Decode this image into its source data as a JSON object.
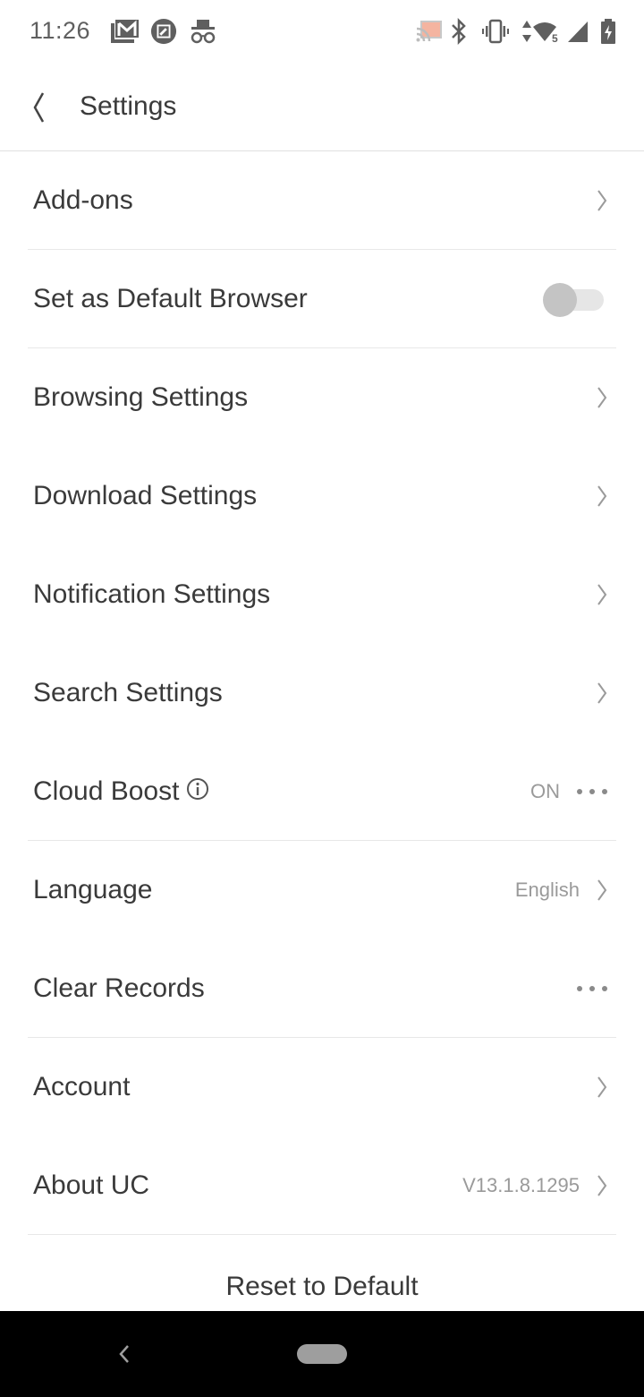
{
  "status_bar": {
    "time": "11:26",
    "left_icons": [
      "gmail-icon",
      "screenshot-edit-icon",
      "incognito-icon"
    ],
    "right_icons": [
      "cast-icon",
      "bluetooth-icon",
      "vibrate-icon",
      "data-arrows-icon",
      "wifi-icon",
      "signal-icon",
      "battery-charging-icon"
    ],
    "wifi_badge": "5",
    "cast_color": "#f4b4a0"
  },
  "header": {
    "back_icon": "chevron-left-icon",
    "title": "Settings"
  },
  "settings": {
    "items": [
      {
        "label": "Add-ons",
        "control": "chevron"
      },
      {
        "label": "Set as Default Browser",
        "control": "toggle",
        "toggle_on": false
      },
      {
        "label": "Browsing Settings",
        "control": "chevron"
      },
      {
        "label": "Download Settings",
        "control": "chevron"
      },
      {
        "label": "Notification Settings",
        "control": "chevron"
      },
      {
        "label": "Search Settings",
        "control": "chevron"
      },
      {
        "label": "Cloud Boost",
        "control": "more",
        "value": "ON",
        "has_info_icon": true
      },
      {
        "label": "Language",
        "control": "chevron",
        "value": "English"
      },
      {
        "label": "Clear Records",
        "control": "more"
      },
      {
        "label": "Account",
        "control": "chevron"
      },
      {
        "label": "About UC",
        "control": "chevron",
        "value": "V13.1.8.1295"
      }
    ]
  },
  "footer": {
    "reset_label": "Reset to Default"
  },
  "nav_bar": {
    "back_icon": "nav-back-icon",
    "home_icon": "nav-home-pill-icon"
  }
}
